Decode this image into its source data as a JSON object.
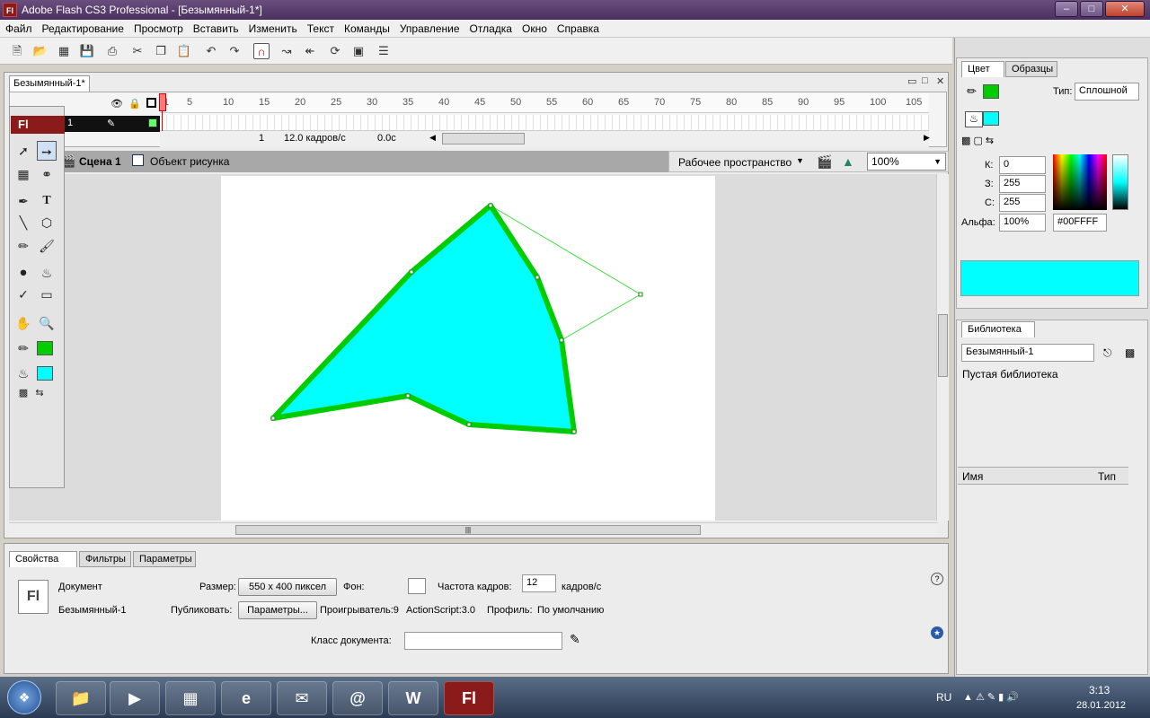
{
  "window": {
    "title": "Adobe Flash CS3 Professional - [Безымянный-1*]",
    "app_icon": "Fl"
  },
  "menu": [
    "Файл",
    "Редактирование",
    "Просмотр",
    "Вставить",
    "Изменить",
    "Текст",
    "Команды",
    "Управление",
    "Отладка",
    "Окно",
    "Справка"
  ],
  "document": {
    "tab": "Безымянный-1*"
  },
  "timeline": {
    "ticks": [
      "1",
      "5",
      "10",
      "15",
      "20",
      "25",
      "30",
      "35",
      "40",
      "45",
      "50",
      "55",
      "60",
      "65",
      "70",
      "75",
      "80",
      "85",
      "90",
      "95",
      "100",
      "105"
    ],
    "layer_number": "1",
    "current_frame": "1",
    "fps_text": "12.0 кадров/с",
    "time_text": "0.0с"
  },
  "editbar": {
    "scene": "Сцена 1",
    "object": "Объект рисунка",
    "workspace": "Рабочее пространство",
    "zoom": "100%"
  },
  "tools_header": "Fl",
  "colors": {
    "stroke": "#00CC00",
    "fill": "#00FFFF",
    "stage": "#FFFFFF"
  },
  "properties": {
    "tabs": [
      "Свойства",
      "Фильтры",
      "Параметры"
    ],
    "doc_label": "Документ",
    "doc_name": "Безымянный-1",
    "size_label": "Размер:",
    "size_value": "550 x 400 пиксел",
    "bg_label": "Фон:",
    "fps_label": "Частота кадров:",
    "fps_value": "12",
    "fps_unit": "кадров/с",
    "publish_label": "Публиковать:",
    "publish_btn": "Параметры...",
    "player": "Проигрыватель:9",
    "actionscript": "ActionScript:3.0",
    "profile_label": "Профиль:",
    "profile_value": "По умолчанию",
    "class_label": "Класс документа:",
    "class_value": ""
  },
  "color_panel": {
    "tabs": [
      "Цвет",
      "Образцы"
    ],
    "type_label": "Тип:",
    "type_value": "Сплошной",
    "r_label": "К:",
    "r_value": "0",
    "g_label": "З:",
    "g_value": "255",
    "b_label": "С:",
    "b_value": "255",
    "alpha_label": "Альфа:",
    "alpha_value": "100%",
    "hex": "#00FFFF"
  },
  "library": {
    "tab": "Библиотека",
    "doc": "Безымянный-1",
    "empty": "Пустая библиотека",
    "col_name": "Имя",
    "col_type": "Тип"
  },
  "taskbar": {
    "lang": "RU",
    "time": "3:13",
    "date": "28.01.2012",
    "active_app": "Fl"
  }
}
